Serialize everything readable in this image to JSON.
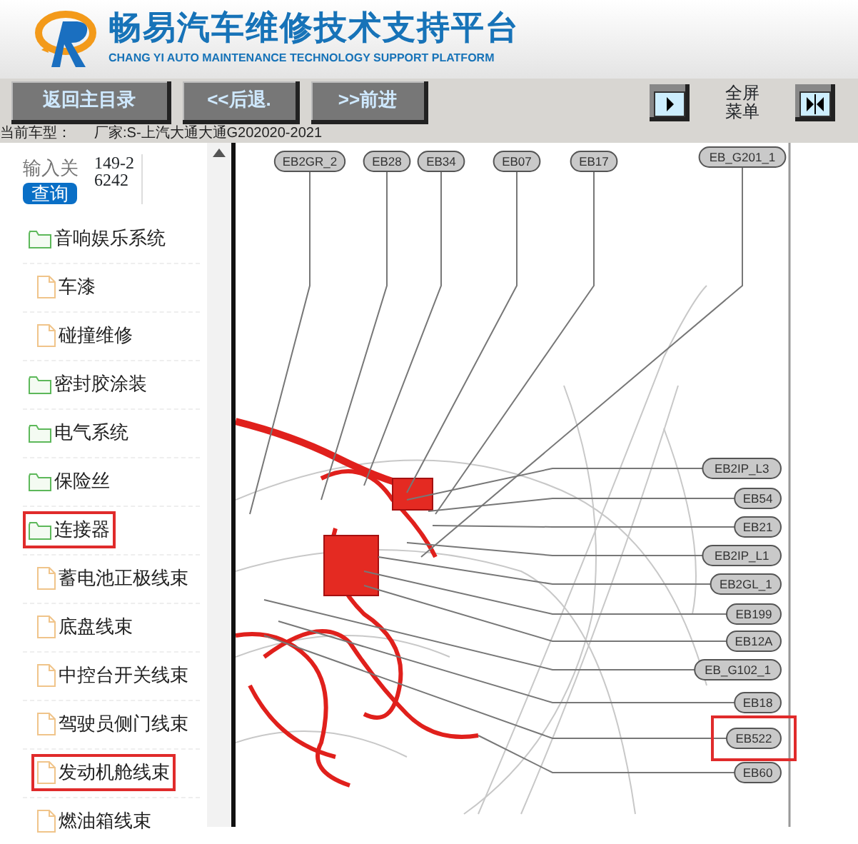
{
  "header": {
    "title": "畅易汽车维修技术支持平台",
    "subtitle": "CHANG YI AUTO MAINTENANCE TECHNOLOGY SUPPORT PLATFORM"
  },
  "toolbar": {
    "buttons": [
      "返回主目录",
      "<<后退.",
      ">>前进"
    ],
    "fullscreen_label": "全屏菜单"
  },
  "vehicle": {
    "label": "当前车型：",
    "value": "厂家:S-上汽大通大通G202020-2021"
  },
  "search": {
    "placeholder": "输入关",
    "button": "查询",
    "value": "149-26242"
  },
  "tree": [
    {
      "label": "音响娱乐系统",
      "kind": "folder",
      "highlighted": false,
      "children": [
        {
          "label": "车漆",
          "kind": "file",
          "highlighted": false
        },
        {
          "label": "碰撞维修",
          "kind": "file",
          "highlighted": false
        }
      ]
    },
    {
      "label": "密封胶涂装",
      "kind": "folder",
      "highlighted": false
    },
    {
      "label": "电气系统",
      "kind": "folder",
      "highlighted": false
    },
    {
      "label": "保险丝",
      "kind": "folder",
      "highlighted": false
    },
    {
      "label": "连接器",
      "kind": "folder",
      "highlighted": true,
      "children": [
        {
          "label": "蓄电池正极线束",
          "kind": "file",
          "highlighted": false
        },
        {
          "label": "底盘线束",
          "kind": "file",
          "highlighted": false
        },
        {
          "label": "中控台开关线束",
          "kind": "file",
          "highlighted": false
        },
        {
          "label": "驾驶员侧门线束",
          "kind": "file",
          "highlighted": false
        },
        {
          "label": "发动机舱线束",
          "kind": "file",
          "highlighted": true
        },
        {
          "label": "燃油箱线束",
          "kind": "file",
          "highlighted": false
        }
      ]
    }
  ],
  "diagram": {
    "top_labels": [
      {
        "text": "EB2GR_2",
        "highlighted": false
      },
      {
        "text": "EB28",
        "highlighted": false
      },
      {
        "text": "EB34",
        "highlighted": false
      },
      {
        "text": "EB07",
        "highlighted": false
      },
      {
        "text": "EB17",
        "highlighted": false
      },
      {
        "text": "EB_G201_1",
        "highlighted": false
      }
    ],
    "right_labels": [
      {
        "text": "EB2IP_L3",
        "highlighted": false
      },
      {
        "text": "EB54",
        "highlighted": false
      },
      {
        "text": "EB21",
        "highlighted": false
      },
      {
        "text": "EB2IP_L1",
        "highlighted": false
      },
      {
        "text": "EB2GL_1",
        "highlighted": false
      },
      {
        "text": "EB199",
        "highlighted": false
      },
      {
        "text": "EB12A",
        "highlighted": false
      },
      {
        "text": "EB_G102_1",
        "highlighted": false
      },
      {
        "text": "EB18",
        "highlighted": false
      },
      {
        "text": "EB522",
        "highlighted": true
      },
      {
        "text": "EB60",
        "highlighted": false
      }
    ]
  }
}
